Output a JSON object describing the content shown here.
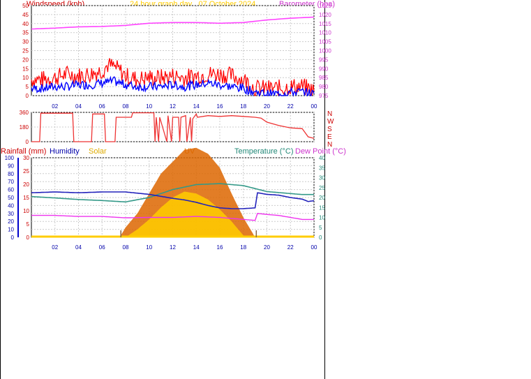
{
  "header": {
    "windspeed_label": "Windspeed (kph)",
    "title": "24 hour graph day , 07 October 2024",
    "barometer_label": "Barometer (hpa)"
  },
  "legend": {
    "rainfall": "Rainfall (mm)",
    "humidity": "Humidity",
    "solar": "Solar",
    "uv": "UV",
    "temperature": "Temperature (°C)",
    "dewpoint": "Dew Point (°C)"
  },
  "compass": [
    "N",
    "W",
    "S",
    "E",
    "N"
  ],
  "colors": {
    "wind_gust": "#ff0000",
    "wind_avg": "#0000ff",
    "barometer": "#ff44ff",
    "direction": "#ee3333",
    "humidity": "#2222bb",
    "temperature": "#339988",
    "dewpoint": "#ee33ee",
    "solar": "#ffcc00",
    "uv": "#dd6600",
    "rainfall_axis": "#0000cc"
  },
  "chart_data": [
    {
      "type": "line",
      "ylabel_left": "Windspeed (kph)",
      "ylabel_right": "Barometer (hpa)",
      "x_ticks": [
        "02",
        "04",
        "06",
        "08",
        "10",
        "12",
        "14",
        "16",
        "18",
        "20",
        "22",
        "00"
      ],
      "y_ticks_left": [
        "0",
        "5",
        "10",
        "15",
        "20",
        "25",
        "30",
        "35",
        "40",
        "45",
        "50"
      ],
      "y_ticks_right": [
        "975",
        "980",
        "985",
        "990",
        "995",
        "1000",
        "1005",
        "1010",
        "1015",
        "1020",
        "1025"
      ],
      "ylim_left": [
        0,
        50
      ],
      "ylim_right": [
        975,
        1025
      ],
      "series": [
        {
          "name": "Windspeed",
          "hours": [
            0,
            1,
            2,
            3,
            4,
            5,
            6,
            6.5,
            7,
            7.5,
            8,
            9,
            10,
            11,
            12,
            13,
            14,
            15,
            16,
            17,
            18,
            18.5,
            19,
            20,
            21,
            22,
            23,
            24
          ],
          "values": [
            9,
            9,
            10,
            12,
            11,
            12,
            14,
            17,
            16,
            14,
            11,
            9,
            10,
            10,
            11,
            10,
            11,
            12,
            12,
            11,
            9,
            7,
            4,
            4,
            4,
            5,
            5,
            3
          ]
        },
        {
          "name": "Average",
          "hours": [
            0,
            1,
            2,
            3,
            4,
            5,
            6,
            7,
            8,
            9,
            10,
            11,
            12,
            13,
            14,
            15,
            16,
            17,
            18,
            19,
            20,
            21,
            22,
            23,
            24
          ],
          "values": [
            4,
            4,
            5,
            5,
            6,
            6,
            7,
            8,
            6,
            5,
            5,
            5,
            6,
            5,
            6,
            7,
            6,
            5,
            4,
            2,
            1,
            1,
            2,
            2,
            1
          ]
        },
        {
          "name": "Barometer",
          "hours": [
            0,
            2,
            4,
            6,
            8,
            10,
            12,
            14,
            16,
            18,
            20,
            22,
            24
          ],
          "values": [
            1012,
            1012.5,
            1013.2,
            1013.4,
            1014,
            1015.2,
            1015.6,
            1015.6,
            1015.2,
            1015.6,
            1017,
            1018,
            1018.6
          ]
        }
      ]
    },
    {
      "type": "line",
      "y_ticks": [
        "0",
        "180",
        "360"
      ],
      "ylim": [
        0,
        360
      ],
      "series": [
        {
          "name": "Wind direction",
          "hours": [
            0,
            0.7,
            0.8,
            3.5,
            3.6,
            5.1,
            5.2,
            6.2,
            6.3,
            7.1,
            7.2,
            8.5,
            8.6,
            10.4,
            10.5,
            10.6,
            10.8,
            10.9,
            11.5,
            11.6,
            11.9,
            12,
            12.5,
            12.6,
            12.7,
            13.1,
            13.2,
            13.5,
            13.6,
            13.7,
            14,
            14.1,
            15,
            16,
            17,
            18,
            19,
            19.5,
            20,
            21,
            22,
            23,
            23.5,
            24
          ],
          "values": [
            0,
            0,
            350,
            350,
            0,
            0,
            340,
            340,
            0,
            0,
            300,
            300,
            355,
            355,
            0,
            300,
            0,
            300,
            0,
            320,
            0,
            300,
            300,
            0,
            300,
            320,
            0,
            300,
            0,
            280,
            340,
            300,
            320,
            310,
            320,
            310,
            300,
            290,
            240,
            200,
            170,
            160,
            60,
            40
          ]
        }
      ]
    },
    {
      "type": "line",
      "ylabel_left": "Humidity",
      "ylabel_right": "Temperature (°C)",
      "x_ticks": [
        "02",
        "04",
        "06",
        "08",
        "10",
        "12",
        "14",
        "16",
        "18",
        "20",
        "22",
        "00"
      ],
      "y_ticks_left": [
        "0",
        "10",
        "20",
        "30",
        "40",
        "50",
        "60",
        "70",
        "80",
        "90",
        "100"
      ],
      "y_ticks_rain": [
        "0",
        "5",
        "10",
        "15",
        "20",
        "25",
        "30"
      ],
      "y_ticks_right": [
        "0",
        "5",
        "10",
        "15",
        "20",
        "25",
        "30",
        "35",
        "40"
      ],
      "ylim_left": [
        0,
        100
      ],
      "ylim_right": [
        0,
        40
      ],
      "series": [
        {
          "name": "Humidity",
          "hours": [
            0,
            2,
            4,
            6,
            8,
            10,
            12,
            13,
            14,
            15,
            16,
            17,
            18,
            19,
            19.2,
            20,
            21,
            22,
            23,
            23.5,
            24
          ],
          "values": [
            56,
            57,
            56,
            57,
            57,
            54,
            49,
            47,
            44,
            40,
            37,
            36,
            36,
            37,
            56,
            54,
            53,
            50,
            48,
            45,
            46
          ]
        },
        {
          "name": "Temperature",
          "hours": [
            0,
            2,
            4,
            6,
            8,
            10,
            12,
            14,
            16,
            18,
            19,
            20,
            21,
            22,
            23,
            24
          ],
          "values": [
            20.5,
            19.8,
            19,
            18.5,
            17.8,
            20,
            24,
            26.5,
            27,
            26,
            24.5,
            23,
            22.5,
            22,
            21.5,
            21.5
          ]
        },
        {
          "name": "Dew Point",
          "hours": [
            0,
            2,
            4,
            6,
            8,
            10,
            12,
            14,
            16,
            18,
            19,
            19.2,
            20,
            21,
            22,
            23,
            24
          ],
          "values": [
            11,
            11,
            10.5,
            10.5,
            9.8,
            10,
            10,
            10.5,
            10,
            9,
            8.5,
            12,
            11.5,
            11,
            10,
            9,
            9
          ]
        },
        {
          "name": "Solar",
          "hours": [
            7.5,
            8,
            9,
            10,
            11,
            12,
            13,
            14,
            15,
            16,
            17,
            18,
            19
          ],
          "values": [
            0,
            5,
            12,
            22,
            32,
            38,
            44,
            45,
            42,
            35,
            22,
            10,
            0
          ]
        },
        {
          "name": "UV",
          "hours": [
            8,
            9,
            10,
            11,
            12,
            13,
            14,
            15,
            16,
            17,
            18
          ],
          "values": [
            0,
            4,
            9,
            15,
            20,
            23,
            22,
            19,
            14,
            8,
            1
          ]
        }
      ]
    }
  ]
}
